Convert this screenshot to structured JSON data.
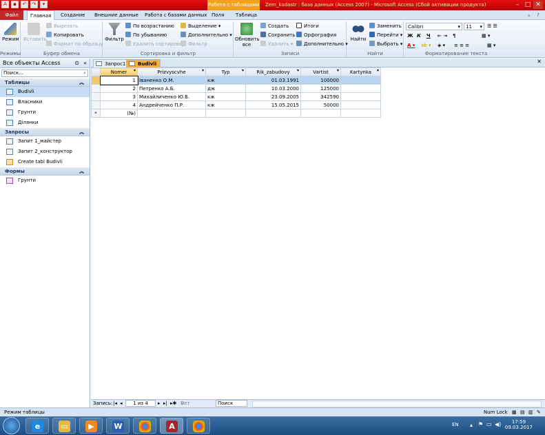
{
  "window": {
    "title": "Zem_kadastr : база данных (Access 2007) - Microsoft Access (Сбой активации продукта)",
    "context_tab": "Работа с таблицами"
  },
  "ribbon_tabs": [
    "Файл",
    "Главная",
    "Создание",
    "Внешние данные",
    "Работа с базами данных",
    "Поля",
    "Таблица"
  ],
  "ribbon": {
    "view_label": "Режим",
    "views_group": "Режимы",
    "paste_label": "Вставить",
    "cut_label": "Вырезать",
    "copy_label": "Копировать",
    "format_painter_label": "Формат по образцу",
    "clipboard_group": "Буфер обмена",
    "filter_label": "Фильтр",
    "sort_asc_label": "По возрастанию",
    "sort_desc_label": "По убыванию",
    "remove_sort_label": "Удалить сортировку",
    "selection_label": "Выделение",
    "advanced_label": "Дополнительно",
    "toggle_filter_label": "Фильтр",
    "sort_group": "Сортировка и фильтр",
    "refresh_label": "Обновить все",
    "new_label": "Создать",
    "save_label": "Сохранить",
    "delete_label": "Удалить",
    "totals_label": "Итоги",
    "spelling_label": "Орфография",
    "more_label": "Дополнительно",
    "records_group": "Записи",
    "find_label": "Найти",
    "replace_label": "Заменить",
    "goto_label": "Перейти",
    "select_label": "Выбрать",
    "find_group": "Найти",
    "font_name": "Calibri",
    "font_size": "11",
    "bold": "Ж",
    "italic": "К",
    "underline": "Ч",
    "text_group": "Форматирование текста"
  },
  "nav": {
    "header": "Все объекты Access",
    "search_placeholder": "Поиск...",
    "sections": [
      {
        "title": "Таблицы",
        "items": [
          "Budivli",
          "Власники",
          "Грунти",
          "Ділянки"
        ]
      },
      {
        "title": "Запросы",
        "items": [
          "Запит 1_майстер",
          "Запит 2_конструктор",
          "Create tabl Budivli"
        ]
      },
      {
        "title": "Формы",
        "items": [
          "Грунти"
        ]
      }
    ]
  },
  "doc_tabs": [
    "Запрос1",
    "Budivli"
  ],
  "table": {
    "columns": [
      "Nomer",
      "Prizvyscvhe",
      "Typ",
      "Rik_zabudovy",
      "Vartist",
      "Kartynka"
    ],
    "rows": [
      [
        "1",
        "Іваненко О.М.",
        "кж",
        "01.03.1991",
        "100000",
        ""
      ],
      [
        "2",
        "Петренко А.Б.",
        "дж",
        "10.03.2000",
        "125000",
        ""
      ],
      [
        "3",
        "Михайличенко Ю.Б.",
        "кж",
        "23.09.2005",
        "342590",
        ""
      ],
      [
        "4",
        "Андрейченко П.Р.",
        "кж",
        "15.05.2015",
        "50000",
        ""
      ]
    ],
    "new_row": "(№)",
    "new_row_marker": "*"
  },
  "record_bar": {
    "label": "Запись:",
    "position": "1 из 4",
    "filter": "Нет фильтра",
    "search": "Поиск"
  },
  "status": {
    "mode": "Режим таблицы",
    "numlock": "Num Lock"
  },
  "taskbar": {
    "lang": "EN",
    "time": "17:59",
    "date": "09.03.2017"
  }
}
